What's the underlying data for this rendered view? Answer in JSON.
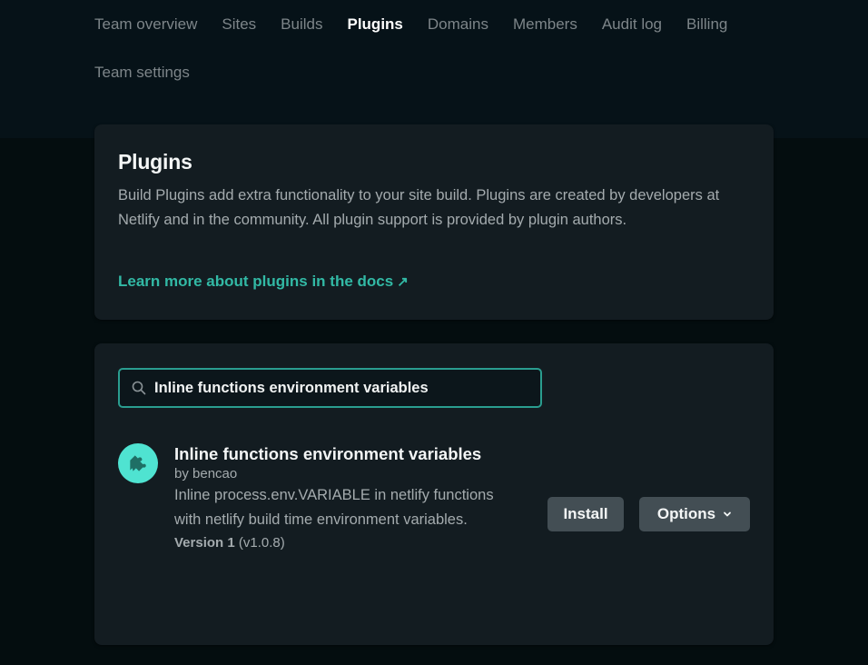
{
  "nav": {
    "items": [
      {
        "label": "Team overview",
        "active": false
      },
      {
        "label": "Sites",
        "active": false
      },
      {
        "label": "Builds",
        "active": false
      },
      {
        "label": "Plugins",
        "active": true
      },
      {
        "label": "Domains",
        "active": false
      },
      {
        "label": "Members",
        "active": false
      },
      {
        "label": "Audit log",
        "active": false
      },
      {
        "label": "Billing",
        "active": false
      },
      {
        "label": "Team settings",
        "active": false
      }
    ]
  },
  "intro": {
    "title": "Plugins",
    "description": "Build Plugins add extra functionality to your site build. Plugins are created by developers at Netlify and in the community. All plugin support is provided by plugin authors.",
    "link_label": "Learn more about plugins in the docs",
    "link_icon": "external-arrow-icon",
    "link_arrow": "↗"
  },
  "search": {
    "icon": "search-icon",
    "value": "Inline functions environment variables",
    "placeholder": ""
  },
  "plugins": [
    {
      "icon": "puzzle-piece-icon",
      "name": "Inline functions environment variables",
      "author": "by bencao",
      "description": "Inline process.env.VARIABLE in netlify functions with netlify build time environment variables.",
      "version_label": "Version 1",
      "version_number": "(v1.0.8)",
      "install_label": "Install",
      "options_label": "Options"
    }
  ],
  "colors": {
    "accent": "#32b9a5",
    "search_border": "#2a9d8f",
    "plugin_logo_bg": "#4fe3d1",
    "plugin_logo_fg": "#1f6f65",
    "button_bg": "#434e54",
    "card_bg": "#131c21",
    "page_bg": "#040d0f",
    "header_bg": "#061218"
  }
}
